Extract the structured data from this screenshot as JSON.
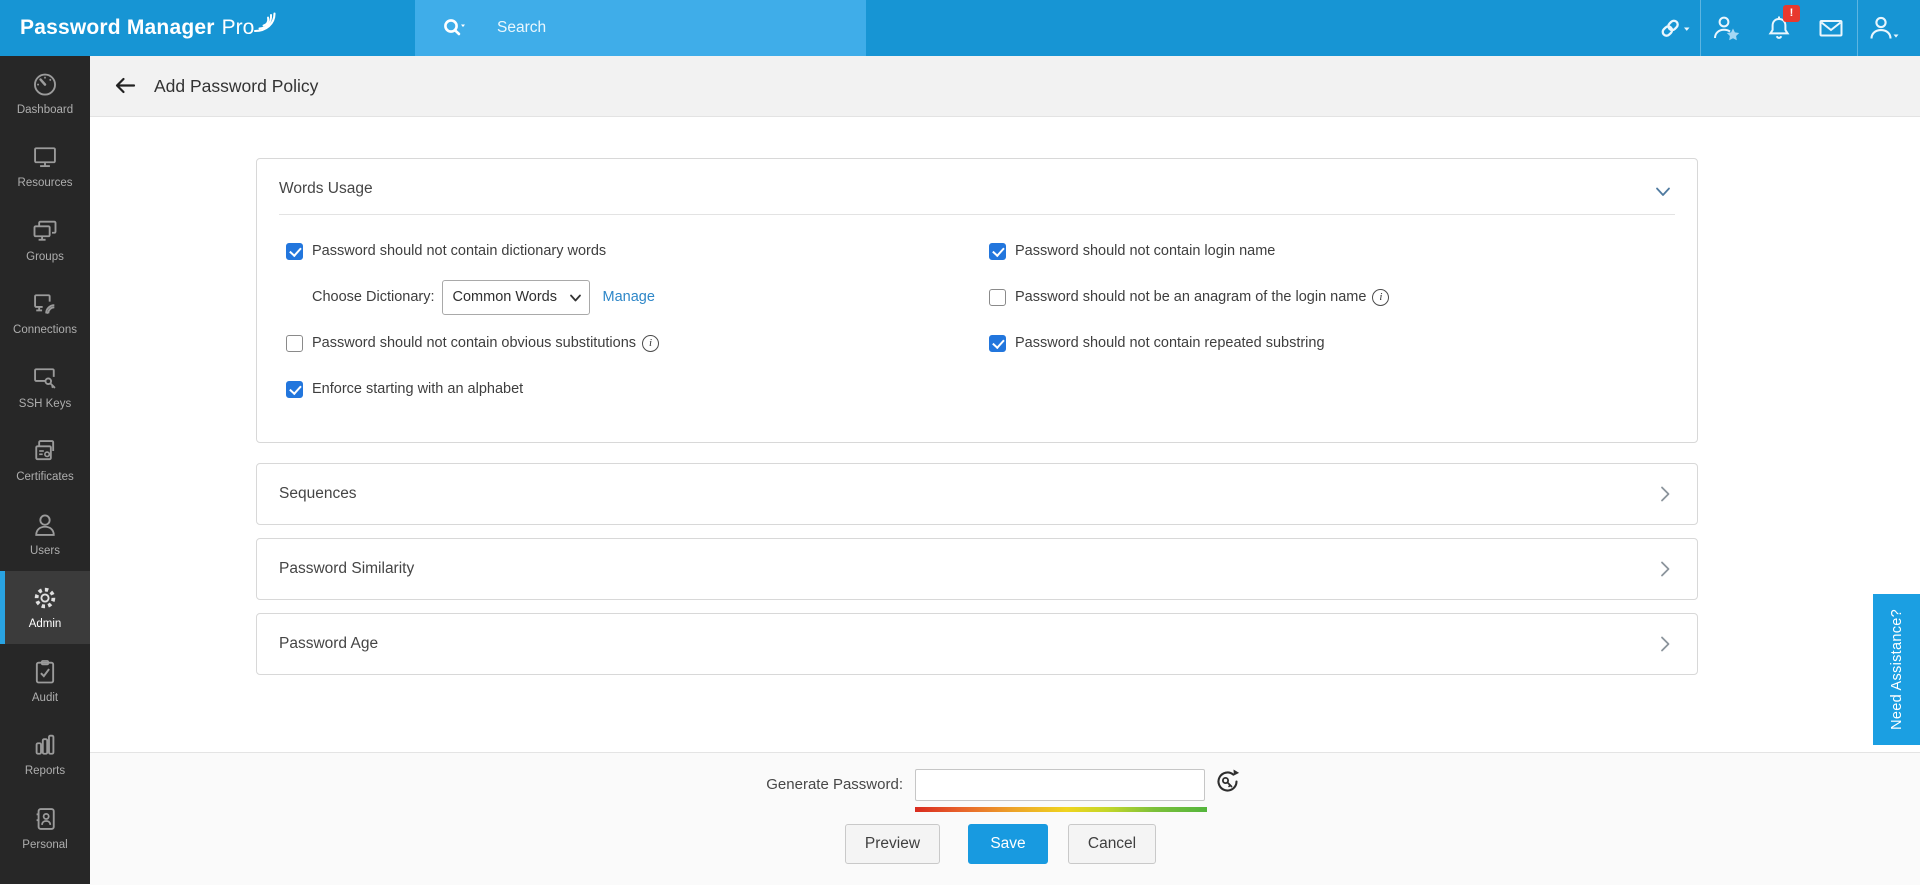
{
  "topbar": {
    "logo_bold": "Password Manager",
    "logo_light": "Pro",
    "search_placeholder": "Search",
    "notification_badge": "!"
  },
  "icons": {
    "search": "magnifier-with-caret",
    "password_link": "chain-link",
    "favorites": "user-with-star",
    "notifications": "bell",
    "mail": "envelope",
    "account": "user-with-caret",
    "back": "arrow-left",
    "words_usage_state": "chevron-down",
    "collapsed_state": "chevron-right",
    "generate_password": "circular-arrow-with-key",
    "info_glyph": "i"
  },
  "sidebar": {
    "items": [
      {
        "label": "Dashboard",
        "active": false
      },
      {
        "label": "Resources",
        "active": false
      },
      {
        "label": "Groups",
        "active": false
      },
      {
        "label": "Connections",
        "active": false
      },
      {
        "label": "SSH Keys",
        "active": false
      },
      {
        "label": "Certificates",
        "active": false
      },
      {
        "label": "Users",
        "active": false
      },
      {
        "label": "Admin",
        "active": true
      },
      {
        "label": "Audit",
        "active": false
      },
      {
        "label": "Reports",
        "active": false
      },
      {
        "label": "Personal",
        "active": false
      }
    ]
  },
  "header": {
    "title": "Add Password Policy"
  },
  "main": {
    "words_usage": {
      "title": "Words Usage",
      "rows_left": [
        {
          "checked": true,
          "label": "Password should not contain dictionary words"
        },
        {
          "label": "Choose Dictionary:",
          "select_value": "Common Words",
          "link": "Manage"
        },
        {
          "checked": false,
          "label": "Password should not contain obvious substitutions",
          "info": true
        },
        {
          "checked": true,
          "label": "Enforce starting with an alphabet"
        }
      ],
      "rows_right": [
        {
          "checked": true,
          "label": "Password should not contain login name"
        },
        {
          "checked": false,
          "label": "Password should not be an anagram of the login name",
          "info": true
        },
        {
          "checked": true,
          "label": "Password should not contain repeated substring"
        }
      ]
    },
    "collapsed_sections": [
      {
        "title": "Sequences"
      },
      {
        "title": "Password Similarity"
      },
      {
        "title": "Password Age"
      }
    ]
  },
  "assist_tab_label": "Need Assistance?",
  "footer": {
    "generate_label": "Generate Password:",
    "generate_value": "",
    "preview_label": "Preview",
    "save_label": "Save",
    "cancel_label": "Cancel"
  },
  "colors": {
    "topbar_blue": "#1795d4",
    "search_blue": "#3fade9",
    "save_blue": "#189ae0",
    "link_blue": "#2e87c8",
    "checkbox_blue": "#2276dd",
    "badge_red": "#e8392e",
    "sidebar_bg": "#272727",
    "sidebar_active_bg": "#3b3b3b",
    "active_stripe_blue": "#29a3e2",
    "assist_tab_blue": "#1b9fe2",
    "strength_gradient": [
      "#d92b1f",
      "#e8642b",
      "#eda428",
      "#efd41f",
      "#c3d629",
      "#7cc03a",
      "#54b53c"
    ]
  }
}
